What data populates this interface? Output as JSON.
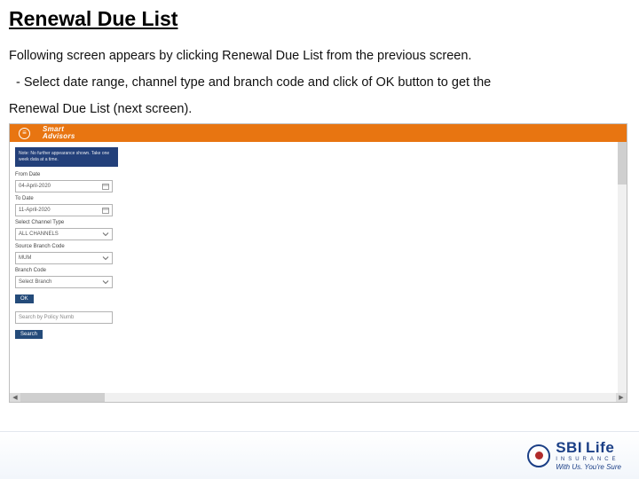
{
  "title": "Renewal Due List",
  "desc_line1": "Following screen appears by clicking Renewal Due List from the previous screen.",
  "desc_line2": "- Select date range, channel type and branch code and click of OK button to get the",
  "desc_line3": "Renewal Due List (next screen).",
  "app": {
    "brand_line1": "Smart",
    "brand_line2": "Advisors",
    "note": "Note: No further appearance shown. Take one week data at a time.",
    "from_label": "From Date",
    "from_value": "04-April-2020",
    "to_label": "To Date",
    "to_value": "11-April-2020",
    "channel_label": "Select Channel Type",
    "channel_value": "ALL CHANNELS",
    "source_label": "Source Branch Code",
    "source_value": "MUM",
    "branch_label": "Branch Code",
    "branch_value": "Select Branch",
    "ok": "OK",
    "search_placeholder": "Search by Policy Numb",
    "search_btn": "Search"
  },
  "footer": {
    "brand_main": "SBI",
    "brand_sub": "Life",
    "brand_line": "INSURANCE",
    "tagline": "With Us. You're Sure"
  }
}
